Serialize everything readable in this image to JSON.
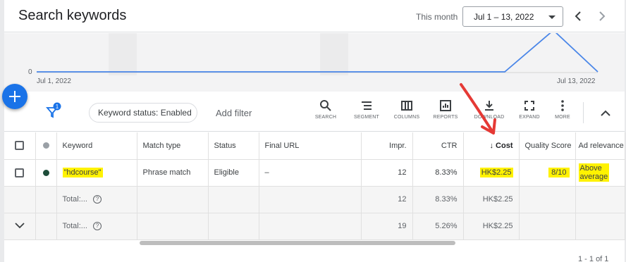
{
  "header": {
    "title": "Search keywords",
    "period_label": "This month",
    "date_range": "Jul 1 – 13, 2022",
    "prev_icon": "chevron-left-icon",
    "next_icon": "chevron-right-icon"
  },
  "chart": {
    "y_tick": "0",
    "x_start_label": "Jul 1, 2022",
    "x_end_label": "Jul 13, 2022",
    "line_color": "#4a86e8"
  },
  "toolbar": {
    "filter_badge": "1",
    "chip_label": "Keyword status: Enabled",
    "add_filter": "Add filter",
    "tools": [
      {
        "label": "SEARCH",
        "icon": "search-icon"
      },
      {
        "label": "SEGMENT",
        "icon": "segment-icon"
      },
      {
        "label": "COLUMNS",
        "icon": "columns-icon"
      },
      {
        "label": "REPORTS",
        "icon": "reports-icon"
      },
      {
        "label": "DOWNLOAD",
        "icon": "download-icon"
      },
      {
        "label": "EXPAND",
        "icon": "expand-icon"
      },
      {
        "label": "MORE",
        "icon": "more-vertical-icon"
      }
    ]
  },
  "table": {
    "headers": {
      "keyword": "Keyword",
      "match_type": "Match type",
      "status": "Status",
      "final_url": "Final URL",
      "impr": "Impr.",
      "ctr": "CTR",
      "cost": "Cost",
      "quality_score": "Quality Score",
      "ad_relevance": "Ad relevance"
    },
    "row": {
      "keyword": "\"hdcourse\"",
      "match_type": "Phrase match",
      "status": "Eligible",
      "final_url": "–",
      "impr": "12",
      "ctr": "8.33%",
      "cost": "HK$2.25",
      "quality_score": "8/10",
      "ad_relevance_line1": "Above",
      "ad_relevance_line2": "average"
    },
    "totals": [
      {
        "label": "Total:...",
        "impr": "12",
        "ctr": "8.33%",
        "cost": "HK$2.25"
      },
      {
        "label": "Total:...",
        "impr": "19",
        "ctr": "5.26%",
        "cost": "HK$2.25"
      }
    ]
  },
  "pagination": "1 - 1 of 1",
  "colors": {
    "accent": "#1a73e8",
    "highlight": "#fff200",
    "annotation_arrow": "#e53935",
    "status_dot": "#1e4d3a"
  }
}
